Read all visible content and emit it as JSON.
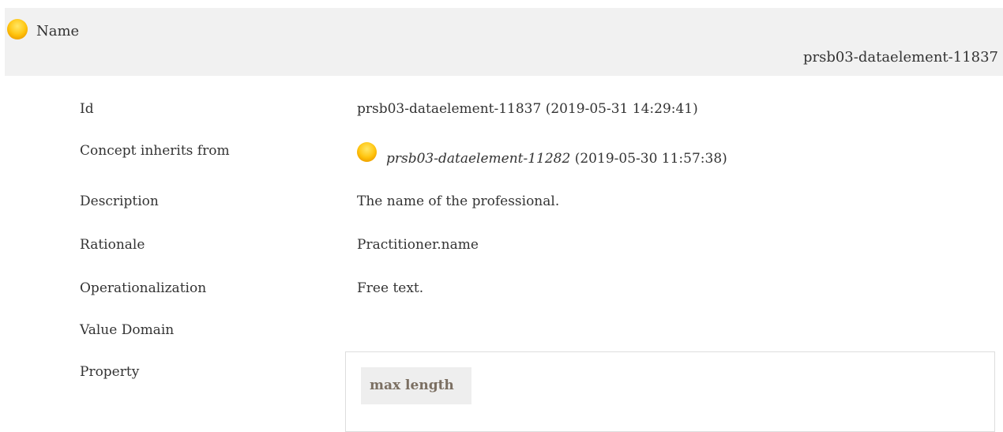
{
  "header": {
    "title": "Name",
    "id": "prsb03-dataelement-11837"
  },
  "rows": {
    "id": {
      "label": "Id",
      "value": "prsb03-dataelement-11837 (2019-05-31 14:29:41)"
    },
    "inherits": {
      "label": "Concept inherits from",
      "ref": "prsb03-dataelement-11282",
      "date": "(2019-05-30 11:57:38)"
    },
    "description": {
      "label": "Description",
      "value": "The name of the professional."
    },
    "rationale": {
      "label": "Rationale",
      "value": "Practitioner.name"
    },
    "operationalization": {
      "label": "Operationalization",
      "value": "Free text."
    },
    "value_domain": {
      "label": "Value Domain",
      "value": ""
    },
    "property": {
      "label": "Property",
      "tag": "max length"
    }
  },
  "colors": {
    "status_dot": "#ffc30a",
    "header_bg": "#f1f1f1",
    "tag_text": "#7b6f62"
  },
  "icons": {
    "status": "yellow-status-dot-icon"
  }
}
